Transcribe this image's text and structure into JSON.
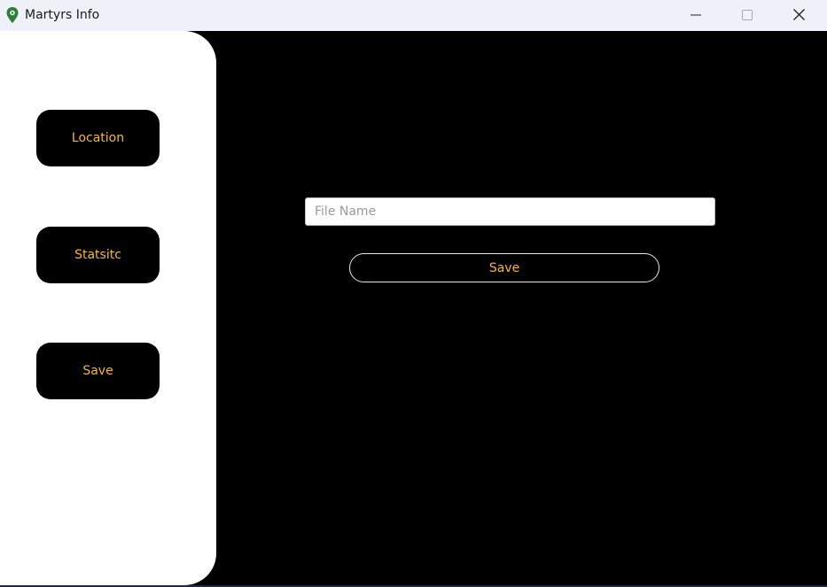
{
  "window": {
    "title": "Martyrs Info",
    "icon": "map-pin-icon",
    "controls": {
      "minimize_icon": "minimize-icon",
      "maximize_icon": "maximize-icon",
      "close_icon": "close-icon"
    }
  },
  "sidebar": {
    "background": "#ffffff",
    "items": [
      {
        "label": "Location"
      },
      {
        "label": "Statsitc"
      },
      {
        "label": "Save"
      }
    ]
  },
  "main": {
    "background": "#000000",
    "file_input": {
      "value": "",
      "placeholder": "File Name"
    },
    "save_button": {
      "label": "Save"
    }
  },
  "colors": {
    "accent_text": "#f5b82e",
    "button_bg": "#000000"
  }
}
